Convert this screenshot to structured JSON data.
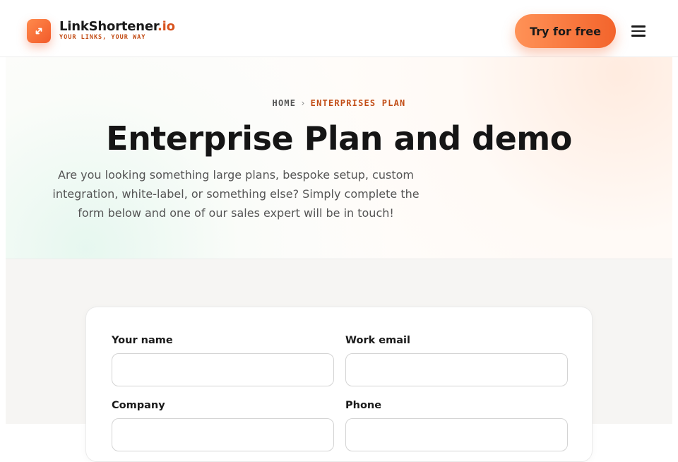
{
  "brand": {
    "name": "LinkShortener",
    "tld": ".io",
    "tagline": "YOUR LINKS, YOUR WAY",
    "accent": "#f25a2a"
  },
  "header": {
    "cta_label": "Try for free",
    "menu_icon": "hamburger-menu-icon"
  },
  "breadcrumb": {
    "home": "HOME",
    "separator": "›",
    "current": "ENTERPRISES PLAN"
  },
  "hero": {
    "title": "Enterprise Plan and demo",
    "description": "Are you looking something large plans, bespoke setup, custom integration, white-label, or something else? Simply complete the form below and one of our sales expert will be in touch!"
  },
  "form": {
    "name": {
      "label": "Your name",
      "value": "",
      "placeholder": ""
    },
    "email": {
      "label": "Work email",
      "value": "",
      "placeholder": ""
    },
    "company": {
      "label": "Company",
      "value": "",
      "placeholder": ""
    },
    "phone": {
      "label": "Phone",
      "value": "",
      "placeholder": ""
    }
  }
}
